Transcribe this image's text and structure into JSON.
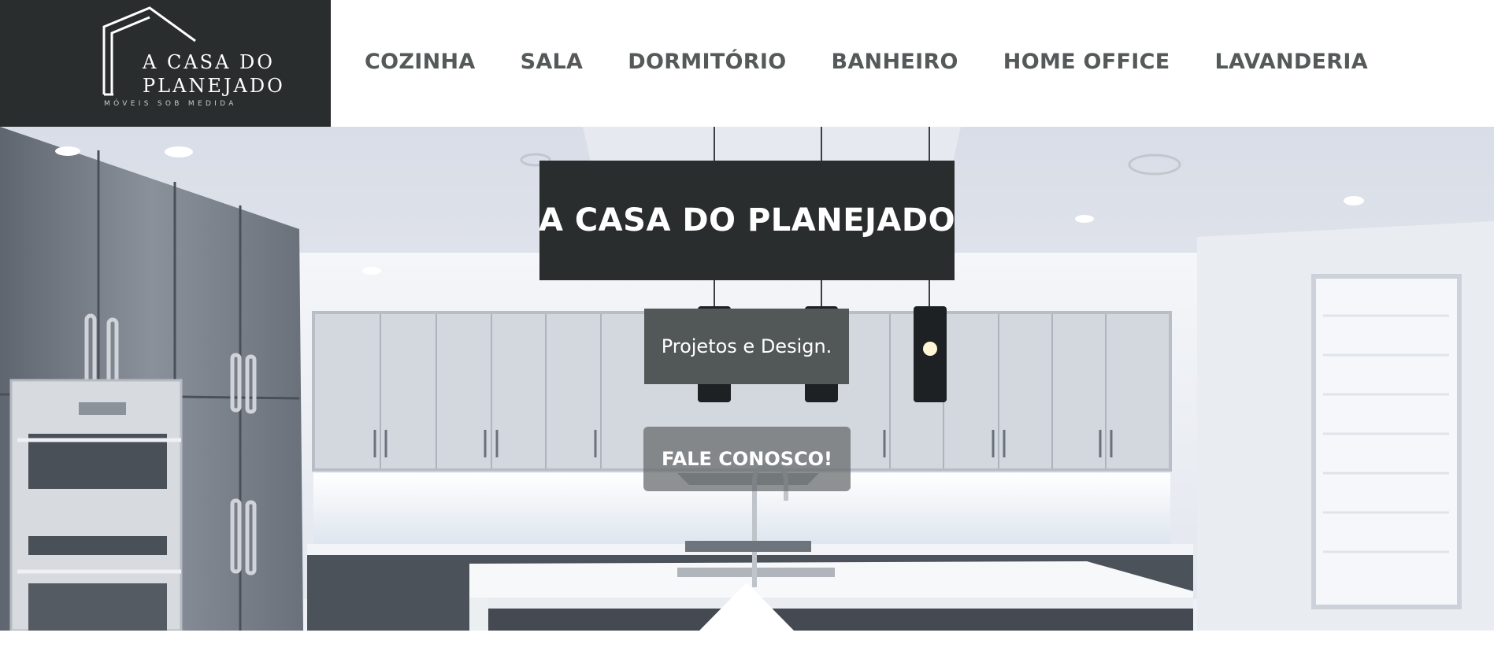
{
  "header": {
    "logo": {
      "line1": "A CASA DO",
      "line2": "PLANEJADO",
      "tagline": "MÓVEIS SOB MEDIDA"
    },
    "nav": [
      {
        "label": "COZINHA"
      },
      {
        "label": "SALA"
      },
      {
        "label": "DORMITÓRIO"
      },
      {
        "label": "BANHEIRO"
      },
      {
        "label": "HOME OFFICE"
      },
      {
        "label": "LAVANDERIA"
      }
    ]
  },
  "hero": {
    "title": "A CASA DO PLANEJADO",
    "subtitle": "Projetos e Design.",
    "cta_label": "FALE CONOSCO!",
    "background": "modern-kitchen-photo"
  },
  "colors": {
    "dark": "#2a2d2d",
    "subtitle_bg": "#525758",
    "nav_text": "#55595a",
    "white": "#ffffff"
  }
}
